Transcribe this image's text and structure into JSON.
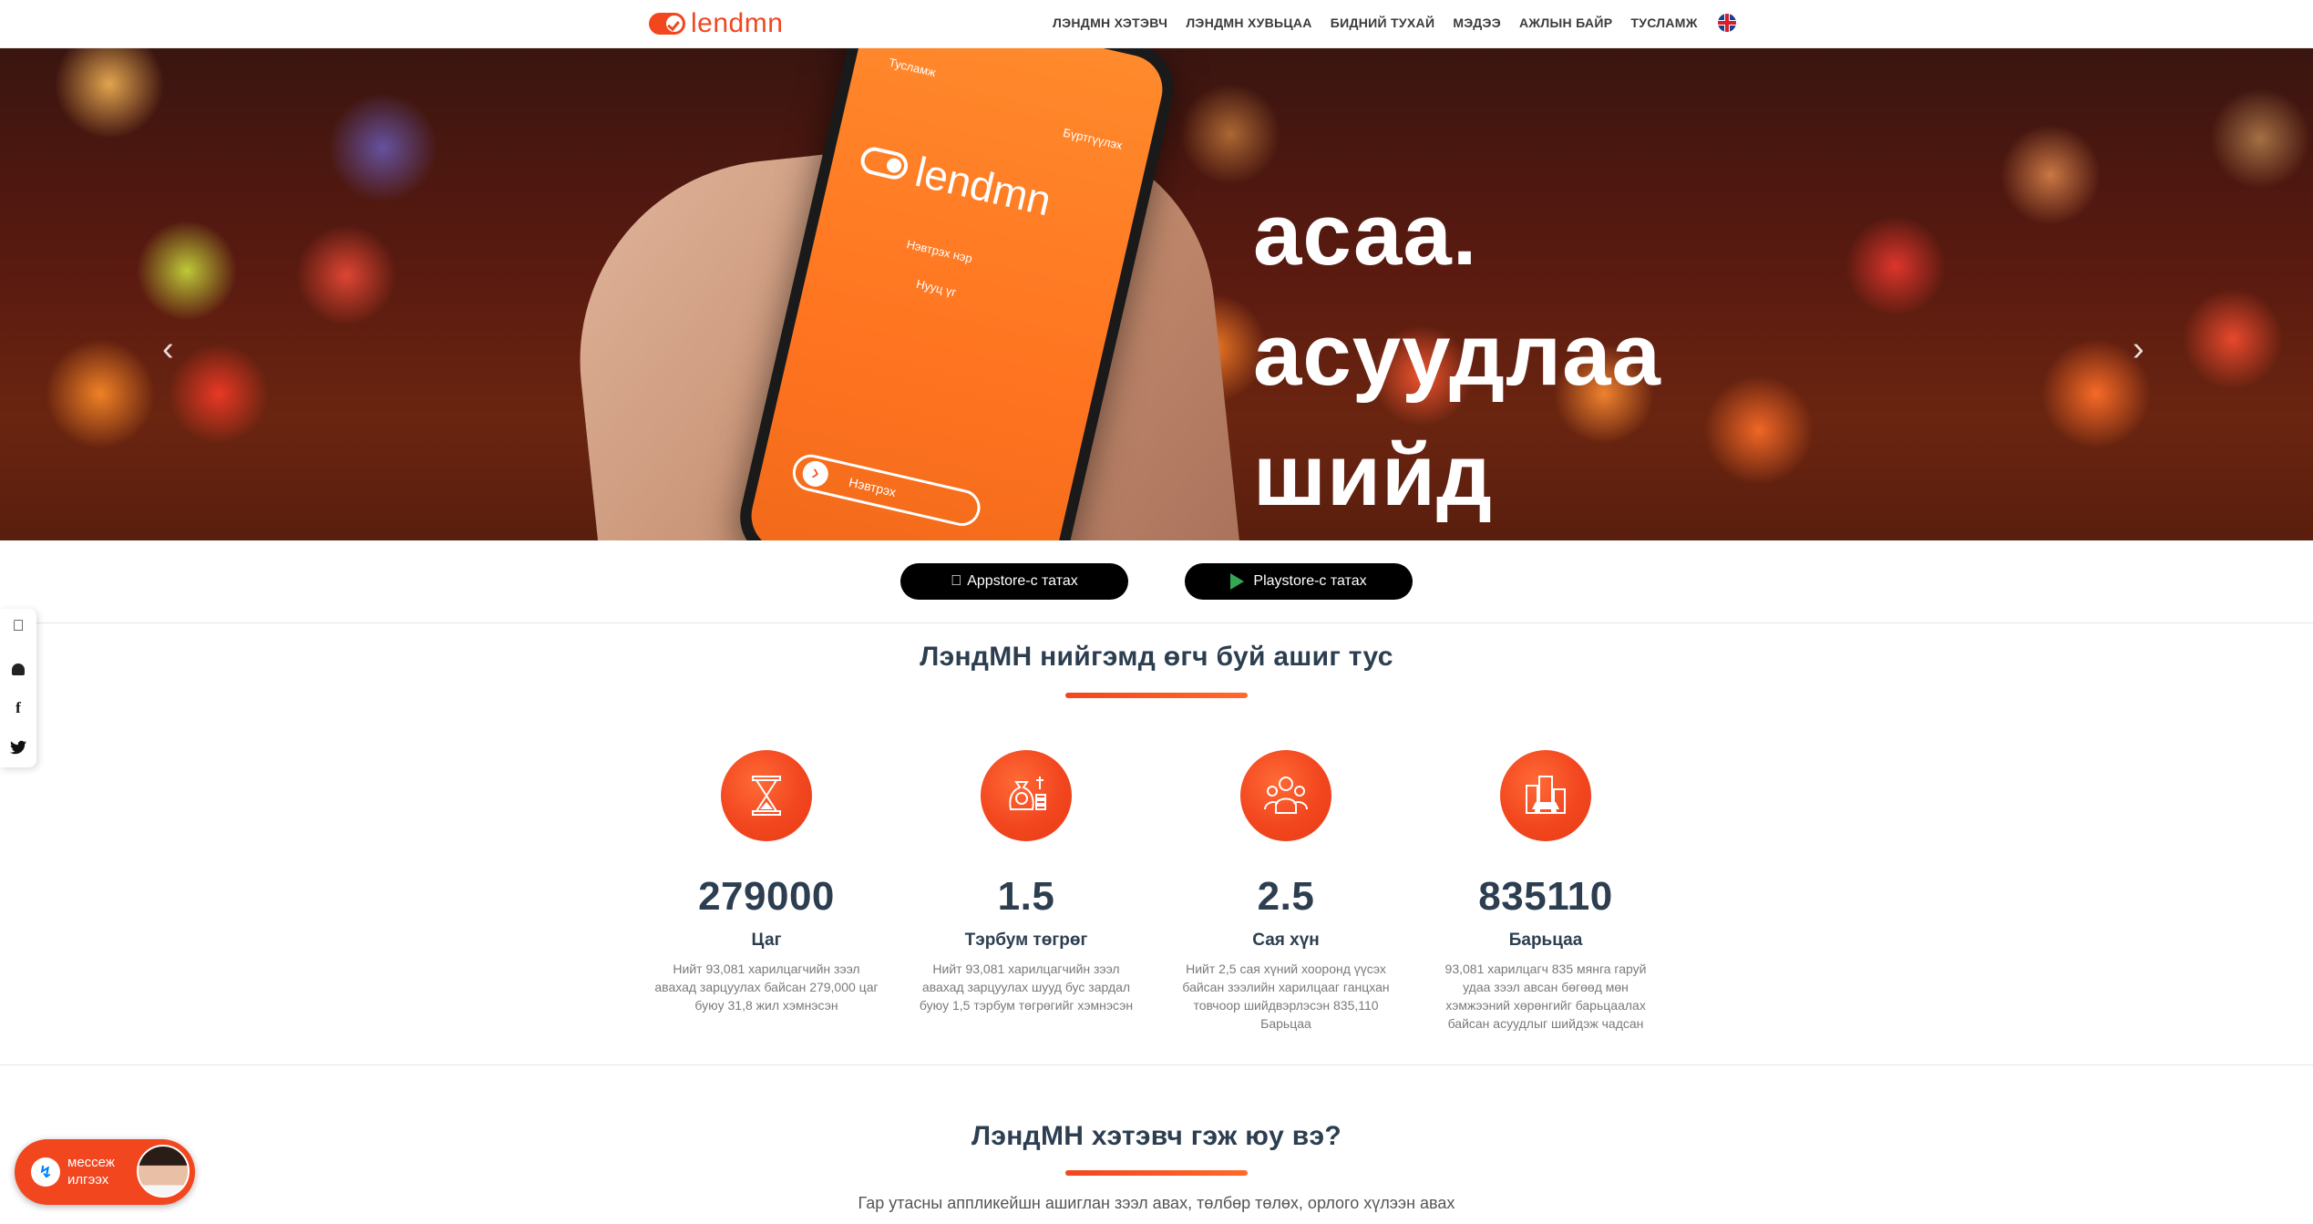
{
  "header": {
    "logo_text": "lendmn",
    "nav": [
      "ЛЭНДМН ХЭТЭВЧ",
      "ЛЭНДМН ХУВЬЦАА",
      "БИДНИЙ ТУХАЙ",
      "МЭДЭЭ",
      "АЖЛЫН БАЙР",
      "ТУСЛАМЖ"
    ],
    "language_icon": "uk-flag-icon"
  },
  "hero": {
    "lines": [
      "асаа.",
      "асуудлаа",
      "шийд"
    ],
    "phone": {
      "top_left": "Тусламж",
      "top_right": "Бүртгүүлэх",
      "logo": "lendmn",
      "field_username": "Нэвтрэх нэр",
      "field_password": "Нууц үг",
      "button": "Нэвтрэх"
    },
    "prev_icon": "‹",
    "next_icon": "›",
    "slides_total": 2,
    "active_slide": 2
  },
  "store": {
    "appstore": "Appstore-с татах",
    "playstore": "Playstore-с татах"
  },
  "social": [
    "apple-icon",
    "android-icon",
    "facebook-icon",
    "twitter-icon"
  ],
  "benefits": {
    "title": "ЛэндМН нийгэмд өгч буй ашиг тус",
    "items": [
      {
        "icon": "hourglass-icon",
        "value": "279000",
        "label": "Цаг",
        "desc": "Нийт 93,081 харилцагчийн зээл авахад зарцуулах байсан 279,000 цаг буюу 31,8 жил хэмнэсэн"
      },
      {
        "icon": "money-bag-icon",
        "value": "1.5",
        "label": "Тэрбум төгрөг",
        "desc": "Нийт 93,081 харилцагчийн зээл авахад зарцуулах шууд бус зардал буюу 1,5 тэрбум төгрөгийг хэмнэсэн"
      },
      {
        "icon": "people-icon",
        "value": "2.5",
        "label": "Сая хүн",
        "desc": "Нийт 2,5 сая хүний хооронд үүсэх байсан зээлийн харилцааг ганцхан товчоор шийдвэрлэсэн 835,110 Барьцаа"
      },
      {
        "icon": "city-car-icon",
        "value": "835110",
        "label": "Барьцаа",
        "desc": "93,081 харилцагч 835 мянга гаруй удаа зээл авсан бөгөөд мөн хэмжээний хөрөнгийг барьцаалах байсан асуудлыг шийдэж чадсан"
      }
    ]
  },
  "wallet": {
    "title": "ЛэндМН хэтэвч гэж юу вэ?",
    "intro": "Гар утасны аппликейшн ашиглан зээл авах, төлбөр төлөх, орлого хүлээн авах"
  },
  "messenger": {
    "line1": "мессеж",
    "line2": "илгээх"
  },
  "colors": {
    "brand": "#f2461f",
    "text_dark": "#2c3e50",
    "text_muted": "#7a7a7a"
  }
}
